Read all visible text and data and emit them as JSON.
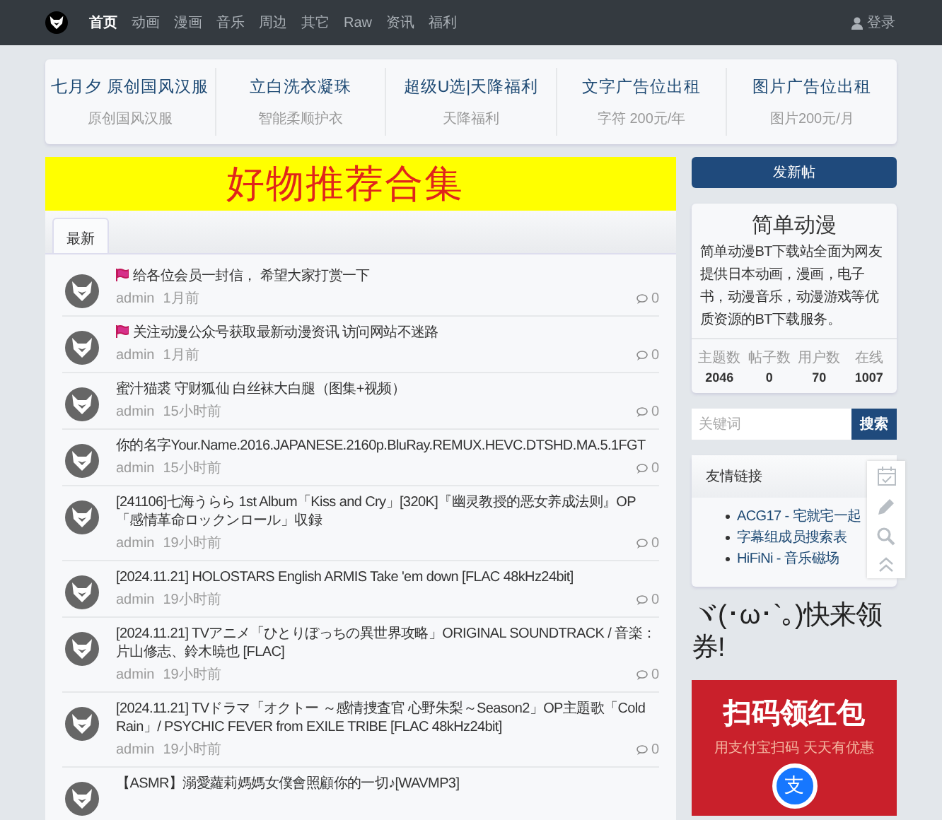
{
  "nav": {
    "items": [
      {
        "label": "首页",
        "selected": true
      },
      {
        "label": "动画",
        "selected": false
      },
      {
        "label": "漫画",
        "selected": false
      },
      {
        "label": "音乐",
        "selected": false
      },
      {
        "label": "周边",
        "selected": false
      },
      {
        "label": "其它",
        "selected": false
      },
      {
        "label": "Raw",
        "selected": false
      },
      {
        "label": "资讯",
        "selected": false
      },
      {
        "label": "福利",
        "selected": false
      }
    ],
    "login": "登录"
  },
  "ads": [
    {
      "title": "七月夕 原创国风汉服",
      "subtitle": "原创国风汉服"
    },
    {
      "title": "立白洗衣凝珠",
      "subtitle": "智能柔顺护衣"
    },
    {
      "title": "超级U选|天降福利",
      "subtitle": "天降福利"
    },
    {
      "title": "文字广告位出租",
      "subtitle": "字符 200元/年"
    },
    {
      "title": "图片广告位出租",
      "subtitle": "图片200元/月"
    }
  ],
  "banner": "好物推荐合集",
  "tabs": [
    {
      "label": "最新",
      "selected": true
    }
  ],
  "posts": [
    {
      "title": "给各位会员一封信， 希望大家打赏一下",
      "pinned": true,
      "author": "admin",
      "time": "1月前",
      "comments": "0"
    },
    {
      "title": "关注动漫公众号获取最新动漫资讯 访问网站不迷路",
      "pinned": true,
      "author": "admin",
      "time": "1月前",
      "comments": "0"
    },
    {
      "title": "蜜汁猫裘 守财狐仙 白丝袜大白腿（图集+视频）",
      "pinned": false,
      "author": "admin",
      "time": "15小时前",
      "comments": "0"
    },
    {
      "title": "你的名字Your.Name.2016.JAPANESE.2160p.BluRay.REMUX.HEVC.DTSHD.MA.5.1FGT",
      "pinned": false,
      "author": "admin",
      "time": "15小时前",
      "comments": "0"
    },
    {
      "title": "[241106]七海うらら 1st Album「Kiss and Cry」[320K]『幽灵教授的恶女养成法则』OP「感情革命ロックンロール」収録",
      "pinned": false,
      "author": "admin",
      "time": "19小时前",
      "comments": "0"
    },
    {
      "title": "[2024.11.21] HOLOSTARS English ARMIS Take 'em down [FLAC 48kHz24bit]",
      "pinned": false,
      "author": "admin",
      "time": "19小时前",
      "comments": "0"
    },
    {
      "title": "[2024.11.21] TVアニメ「ひとりぼっちの異世界攻略」ORIGINAL SOUNDTRACK / 音楽：片山修志、鈴木暁也 [FLAC]",
      "pinned": false,
      "author": "admin",
      "time": "19小时前",
      "comments": "0"
    },
    {
      "title": "[2024.11.21] TVドラマ「オクトー ～感情捜査官 心野朱梨～Season2」OP主題歌「Cold Rain」/ PSYCHIC FEVER from EXILE TRIBE [FLAC 48kHz24bit]",
      "pinned": false,
      "author": "admin",
      "time": "19小时前",
      "comments": "0"
    },
    {
      "title": "【ASMR】溺愛蘿莉媽媽女僕會照顧你的一切♪[WAVMP3]",
      "pinned": false
    }
  ],
  "sidebar": {
    "post_button": "发新帖",
    "site_title": "简单动漫",
    "site_desc": "简单动漫BT下载站全面为网友提供日本动画，漫画，电子书，动漫音乐，动漫游戏等优质资源的BT下载服务。",
    "stats": [
      {
        "label": "主题数",
        "value": "2046"
      },
      {
        "label": "帖子数",
        "value": "0"
      },
      {
        "label": "用户数",
        "value": "70"
      },
      {
        "label": "在线",
        "value": "1007"
      }
    ],
    "search": {
      "placeholder": "关键词",
      "button": "搜索"
    },
    "links_title": "友情链接",
    "links": [
      "ACG17 - 宅就宅一起",
      "字幕组成员搜索表",
      "HiFiNi - 音乐磁场"
    ],
    "promo": "ヾ(･ω･`｡)快来领券!",
    "red_packet": {
      "title": "扫码领红包",
      "subtitle": "用支付宝扫码  天天有优惠",
      "badge": "支"
    }
  }
}
